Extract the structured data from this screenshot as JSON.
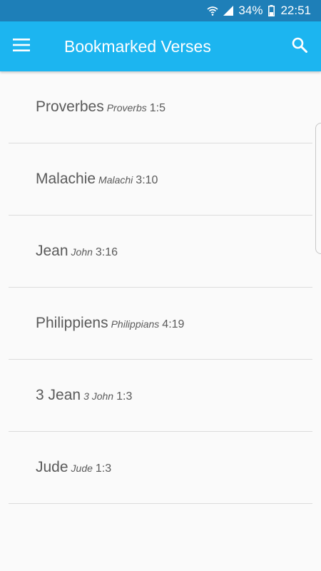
{
  "status_bar": {
    "battery": "34%",
    "time": "22:51",
    "icons": [
      "wifi-icon",
      "signal-icon",
      "battery-icon"
    ]
  },
  "app_bar": {
    "title": "Bookmarked Verses",
    "menu_icon": "menu-icon",
    "search_icon": "search-icon",
    "color": "#1cb5f0"
  },
  "bookmarks": [
    {
      "book_fr": "Proverbes",
      "book_en": "Proverbs",
      "ref": "1:5"
    },
    {
      "book_fr": "Malachie",
      "book_en": "Malachi",
      "ref": "3:10"
    },
    {
      "book_fr": "Jean",
      "book_en": "John",
      "ref": "3:16"
    },
    {
      "book_fr": "Philippiens",
      "book_en": "Philippians",
      "ref": "4:19"
    },
    {
      "book_fr": "3 Jean",
      "book_en": "3 John",
      "ref": "1:3"
    },
    {
      "book_fr": "Jude",
      "book_en": "Jude",
      "ref": "1:3"
    }
  ]
}
